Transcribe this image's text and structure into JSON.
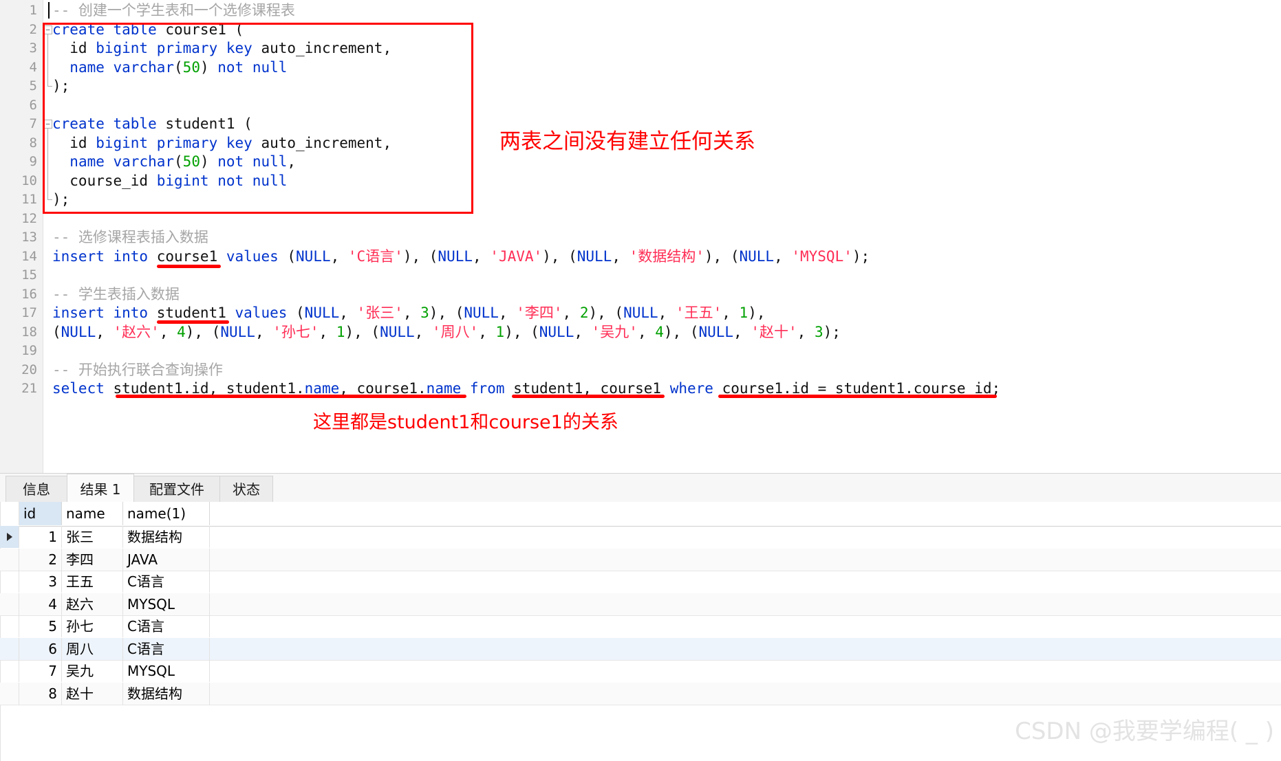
{
  "editor": {
    "caret_line": 1,
    "lines": [
      {
        "n": 1,
        "fold": null,
        "tokens": [
          {
            "t": "-- 创建一个学生表和一个选修课程表",
            "c": "cmt"
          }
        ]
      },
      {
        "n": 2,
        "fold": "open",
        "tokens": [
          {
            "t": "create table",
            "c": "kw"
          },
          {
            "t": " course1 (",
            "c": "plain"
          }
        ]
      },
      {
        "n": 3,
        "fold": null,
        "tokens": [
          {
            "t": "  id ",
            "c": "plain"
          },
          {
            "t": "bigint primary key",
            "c": "kw"
          },
          {
            "t": " auto_increment,",
            "c": "plain"
          }
        ]
      },
      {
        "n": 4,
        "fold": null,
        "tokens": [
          {
            "t": "  ",
            "c": "plain"
          },
          {
            "t": "name varchar",
            "c": "kw"
          },
          {
            "t": "(",
            "c": "plain"
          },
          {
            "t": "50",
            "c": "num"
          },
          {
            "t": ") ",
            "c": "plain"
          },
          {
            "t": "not null",
            "c": "kw"
          }
        ]
      },
      {
        "n": 5,
        "fold": "end",
        "tokens": [
          {
            "t": ");",
            "c": "plain"
          }
        ]
      },
      {
        "n": 6,
        "fold": null,
        "tokens": []
      },
      {
        "n": 7,
        "fold": "open",
        "tokens": [
          {
            "t": "create table",
            "c": "kw"
          },
          {
            "t": " student1 (",
            "c": "plain"
          }
        ]
      },
      {
        "n": 8,
        "fold": null,
        "tokens": [
          {
            "t": "  id ",
            "c": "plain"
          },
          {
            "t": "bigint primary key",
            "c": "kw"
          },
          {
            "t": " auto_increment,",
            "c": "plain"
          }
        ]
      },
      {
        "n": 9,
        "fold": null,
        "tokens": [
          {
            "t": "  ",
            "c": "plain"
          },
          {
            "t": "name varchar",
            "c": "kw"
          },
          {
            "t": "(",
            "c": "plain"
          },
          {
            "t": "50",
            "c": "num"
          },
          {
            "t": ") ",
            "c": "plain"
          },
          {
            "t": "not null",
            "c": "kw"
          },
          {
            "t": ",",
            "c": "plain"
          }
        ]
      },
      {
        "n": 10,
        "fold": null,
        "tokens": [
          {
            "t": "  course_id ",
            "c": "plain"
          },
          {
            "t": "bigint not null",
            "c": "kw"
          }
        ]
      },
      {
        "n": 11,
        "fold": "end",
        "tokens": [
          {
            "t": ");",
            "c": "plain"
          }
        ]
      },
      {
        "n": 12,
        "fold": null,
        "tokens": []
      },
      {
        "n": 13,
        "fold": null,
        "tokens": [
          {
            "t": "-- 选修课程表插入数据",
            "c": "cmt"
          }
        ]
      },
      {
        "n": 14,
        "fold": null,
        "tokens": [
          {
            "t": "insert into",
            "c": "kw"
          },
          {
            "t": " course1 ",
            "c": "plain"
          },
          {
            "t": "values",
            "c": "kw"
          },
          {
            "t": " (",
            "c": "plain"
          },
          {
            "t": "NULL",
            "c": "kw"
          },
          {
            "t": ", ",
            "c": "plain"
          },
          {
            "t": "'C语言'",
            "c": "str"
          },
          {
            "t": "), (",
            "c": "plain"
          },
          {
            "t": "NULL",
            "c": "kw"
          },
          {
            "t": ", ",
            "c": "plain"
          },
          {
            "t": "'JAVA'",
            "c": "str"
          },
          {
            "t": "), (",
            "c": "plain"
          },
          {
            "t": "NULL",
            "c": "kw"
          },
          {
            "t": ", ",
            "c": "plain"
          },
          {
            "t": "'数据结构'",
            "c": "str"
          },
          {
            "t": "), (",
            "c": "plain"
          },
          {
            "t": "NULL",
            "c": "kw"
          },
          {
            "t": ", ",
            "c": "plain"
          },
          {
            "t": "'MYSQL'",
            "c": "str"
          },
          {
            "t": ");",
            "c": "plain"
          }
        ]
      },
      {
        "n": 15,
        "fold": null,
        "tokens": []
      },
      {
        "n": 16,
        "fold": null,
        "tokens": [
          {
            "t": "-- 学生表插入数据",
            "c": "cmt"
          }
        ]
      },
      {
        "n": 17,
        "fold": null,
        "tokens": [
          {
            "t": "insert into",
            "c": "kw"
          },
          {
            "t": " student1 ",
            "c": "plain"
          },
          {
            "t": "values",
            "c": "kw"
          },
          {
            "t": " (",
            "c": "plain"
          },
          {
            "t": "NULL",
            "c": "kw"
          },
          {
            "t": ", ",
            "c": "plain"
          },
          {
            "t": "'张三'",
            "c": "str"
          },
          {
            "t": ", ",
            "c": "plain"
          },
          {
            "t": "3",
            "c": "num"
          },
          {
            "t": "), (",
            "c": "plain"
          },
          {
            "t": "NULL",
            "c": "kw"
          },
          {
            "t": ", ",
            "c": "plain"
          },
          {
            "t": "'李四'",
            "c": "str"
          },
          {
            "t": ", ",
            "c": "plain"
          },
          {
            "t": "2",
            "c": "num"
          },
          {
            "t": "), (",
            "c": "plain"
          },
          {
            "t": "NULL",
            "c": "kw"
          },
          {
            "t": ", ",
            "c": "plain"
          },
          {
            "t": "'王五'",
            "c": "str"
          },
          {
            "t": ", ",
            "c": "plain"
          },
          {
            "t": "1",
            "c": "num"
          },
          {
            "t": "),",
            "c": "plain"
          }
        ]
      },
      {
        "n": 18,
        "fold": null,
        "tokens": [
          {
            "t": "(",
            "c": "plain"
          },
          {
            "t": "NULL",
            "c": "kw"
          },
          {
            "t": ", ",
            "c": "plain"
          },
          {
            "t": "'赵六'",
            "c": "str"
          },
          {
            "t": ", ",
            "c": "plain"
          },
          {
            "t": "4",
            "c": "num"
          },
          {
            "t": "), (",
            "c": "plain"
          },
          {
            "t": "NULL",
            "c": "kw"
          },
          {
            "t": ", ",
            "c": "plain"
          },
          {
            "t": "'孙七'",
            "c": "str"
          },
          {
            "t": ", ",
            "c": "plain"
          },
          {
            "t": "1",
            "c": "num"
          },
          {
            "t": "), (",
            "c": "plain"
          },
          {
            "t": "NULL",
            "c": "kw"
          },
          {
            "t": ", ",
            "c": "plain"
          },
          {
            "t": "'周八'",
            "c": "str"
          },
          {
            "t": ", ",
            "c": "plain"
          },
          {
            "t": "1",
            "c": "num"
          },
          {
            "t": "), (",
            "c": "plain"
          },
          {
            "t": "NULL",
            "c": "kw"
          },
          {
            "t": ", ",
            "c": "plain"
          },
          {
            "t": "'吴九'",
            "c": "str"
          },
          {
            "t": ", ",
            "c": "plain"
          },
          {
            "t": "4",
            "c": "num"
          },
          {
            "t": "), (",
            "c": "plain"
          },
          {
            "t": "NULL",
            "c": "kw"
          },
          {
            "t": ", ",
            "c": "plain"
          },
          {
            "t": "'赵十'",
            "c": "str"
          },
          {
            "t": ", ",
            "c": "plain"
          },
          {
            "t": "3",
            "c": "num"
          },
          {
            "t": ");",
            "c": "plain"
          }
        ]
      },
      {
        "n": 19,
        "fold": null,
        "tokens": []
      },
      {
        "n": 20,
        "fold": null,
        "tokens": [
          {
            "t": "-- 开始执行联合查询操作",
            "c": "cmt"
          }
        ]
      },
      {
        "n": 21,
        "fold": null,
        "tokens": [
          {
            "t": "select",
            "c": "kw"
          },
          {
            "t": " student1.id, student1.",
            "c": "plain"
          },
          {
            "t": "name",
            "c": "kw"
          },
          {
            "t": ", course1.",
            "c": "plain"
          },
          {
            "t": "name",
            "c": "kw"
          },
          {
            "t": " ",
            "c": "plain"
          },
          {
            "t": "from",
            "c": "kw"
          },
          {
            "t": " student1, course1 ",
            "c": "plain"
          },
          {
            "t": "where",
            "c": "kw"
          },
          {
            "t": " course1.id = student1.course_id;",
            "c": "plain"
          }
        ]
      }
    ]
  },
  "annotations": {
    "box_note": "两表之间没有建立任何关系",
    "relation_note": "这里都是student1和course1的关系"
  },
  "tabs": [
    {
      "label": "信息",
      "active": false
    },
    {
      "label": "结果 1",
      "active": true
    },
    {
      "label": "配置文件",
      "active": false
    },
    {
      "label": "状态",
      "active": false
    }
  ],
  "result_grid": {
    "columns": [
      "id",
      "name",
      "name(1)"
    ],
    "rows": [
      {
        "id": "1",
        "name": "张三",
        "name1": "数据结构",
        "current": true
      },
      {
        "id": "2",
        "name": "李四",
        "name1": "JAVA",
        "current": false
      },
      {
        "id": "3",
        "name": "王五",
        "name1": "C语言",
        "current": false
      },
      {
        "id": "4",
        "name": "赵六",
        "name1": "MYSQL",
        "current": false
      },
      {
        "id": "5",
        "name": "孙七",
        "name1": "C语言",
        "current": false
      },
      {
        "id": "6",
        "name": "周八",
        "name1": "C语言",
        "current": false
      },
      {
        "id": "7",
        "name": "吴九",
        "name1": "MYSQL",
        "current": false
      },
      {
        "id": "8",
        "name": "赵十",
        "name1": "数据结构",
        "current": false
      }
    ],
    "highlight_row_index": 5
  },
  "watermark": "CSDN @我要学编程( _ )",
  "colors": {
    "keyword": "#0033cc",
    "string": "#ff2d55",
    "number": "#00a000",
    "comment": "#a6a6a6",
    "annotation": "#ff0000",
    "selection": "#d9e6f4"
  }
}
